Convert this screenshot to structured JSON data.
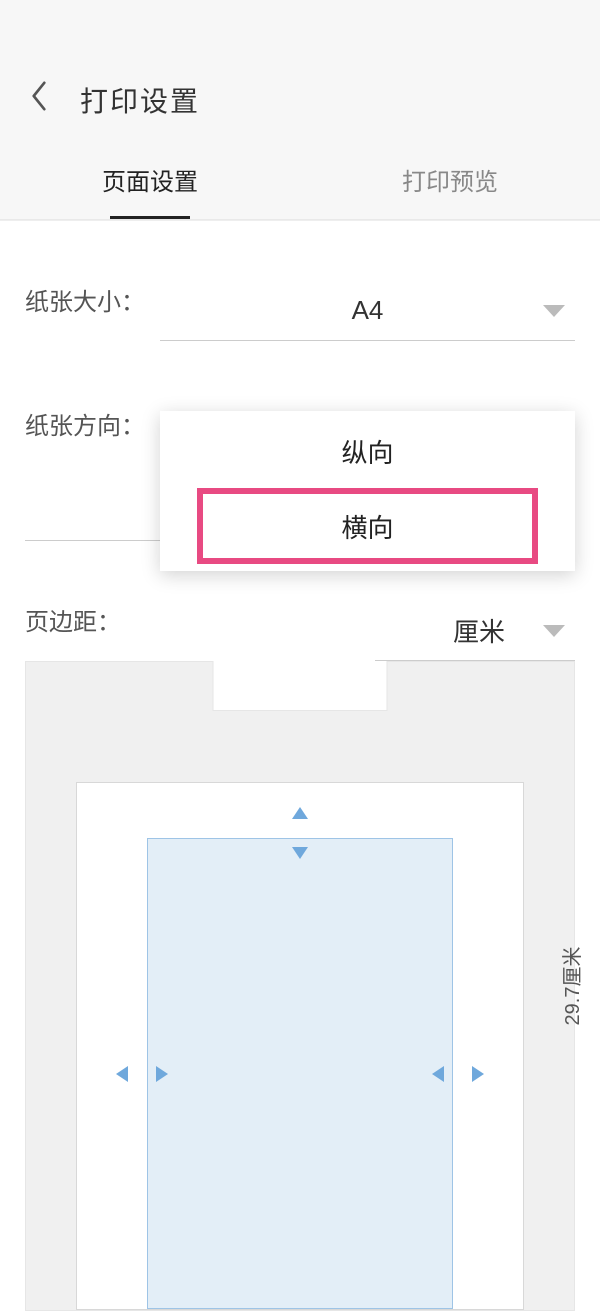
{
  "header": {
    "title": "打印设置"
  },
  "tabs": {
    "page_setup": "页面设置",
    "print_preview": "打印预览"
  },
  "fields": {
    "paper_size": {
      "label": "纸张大小：",
      "value": "A4"
    },
    "orientation": {
      "label": "纸张方向：",
      "options": {
        "portrait": "纵向",
        "landscape": "横向"
      }
    },
    "margin": {
      "label": "页边距：",
      "value": "厘米"
    }
  },
  "preview": {
    "height_label": "29.7厘米"
  }
}
